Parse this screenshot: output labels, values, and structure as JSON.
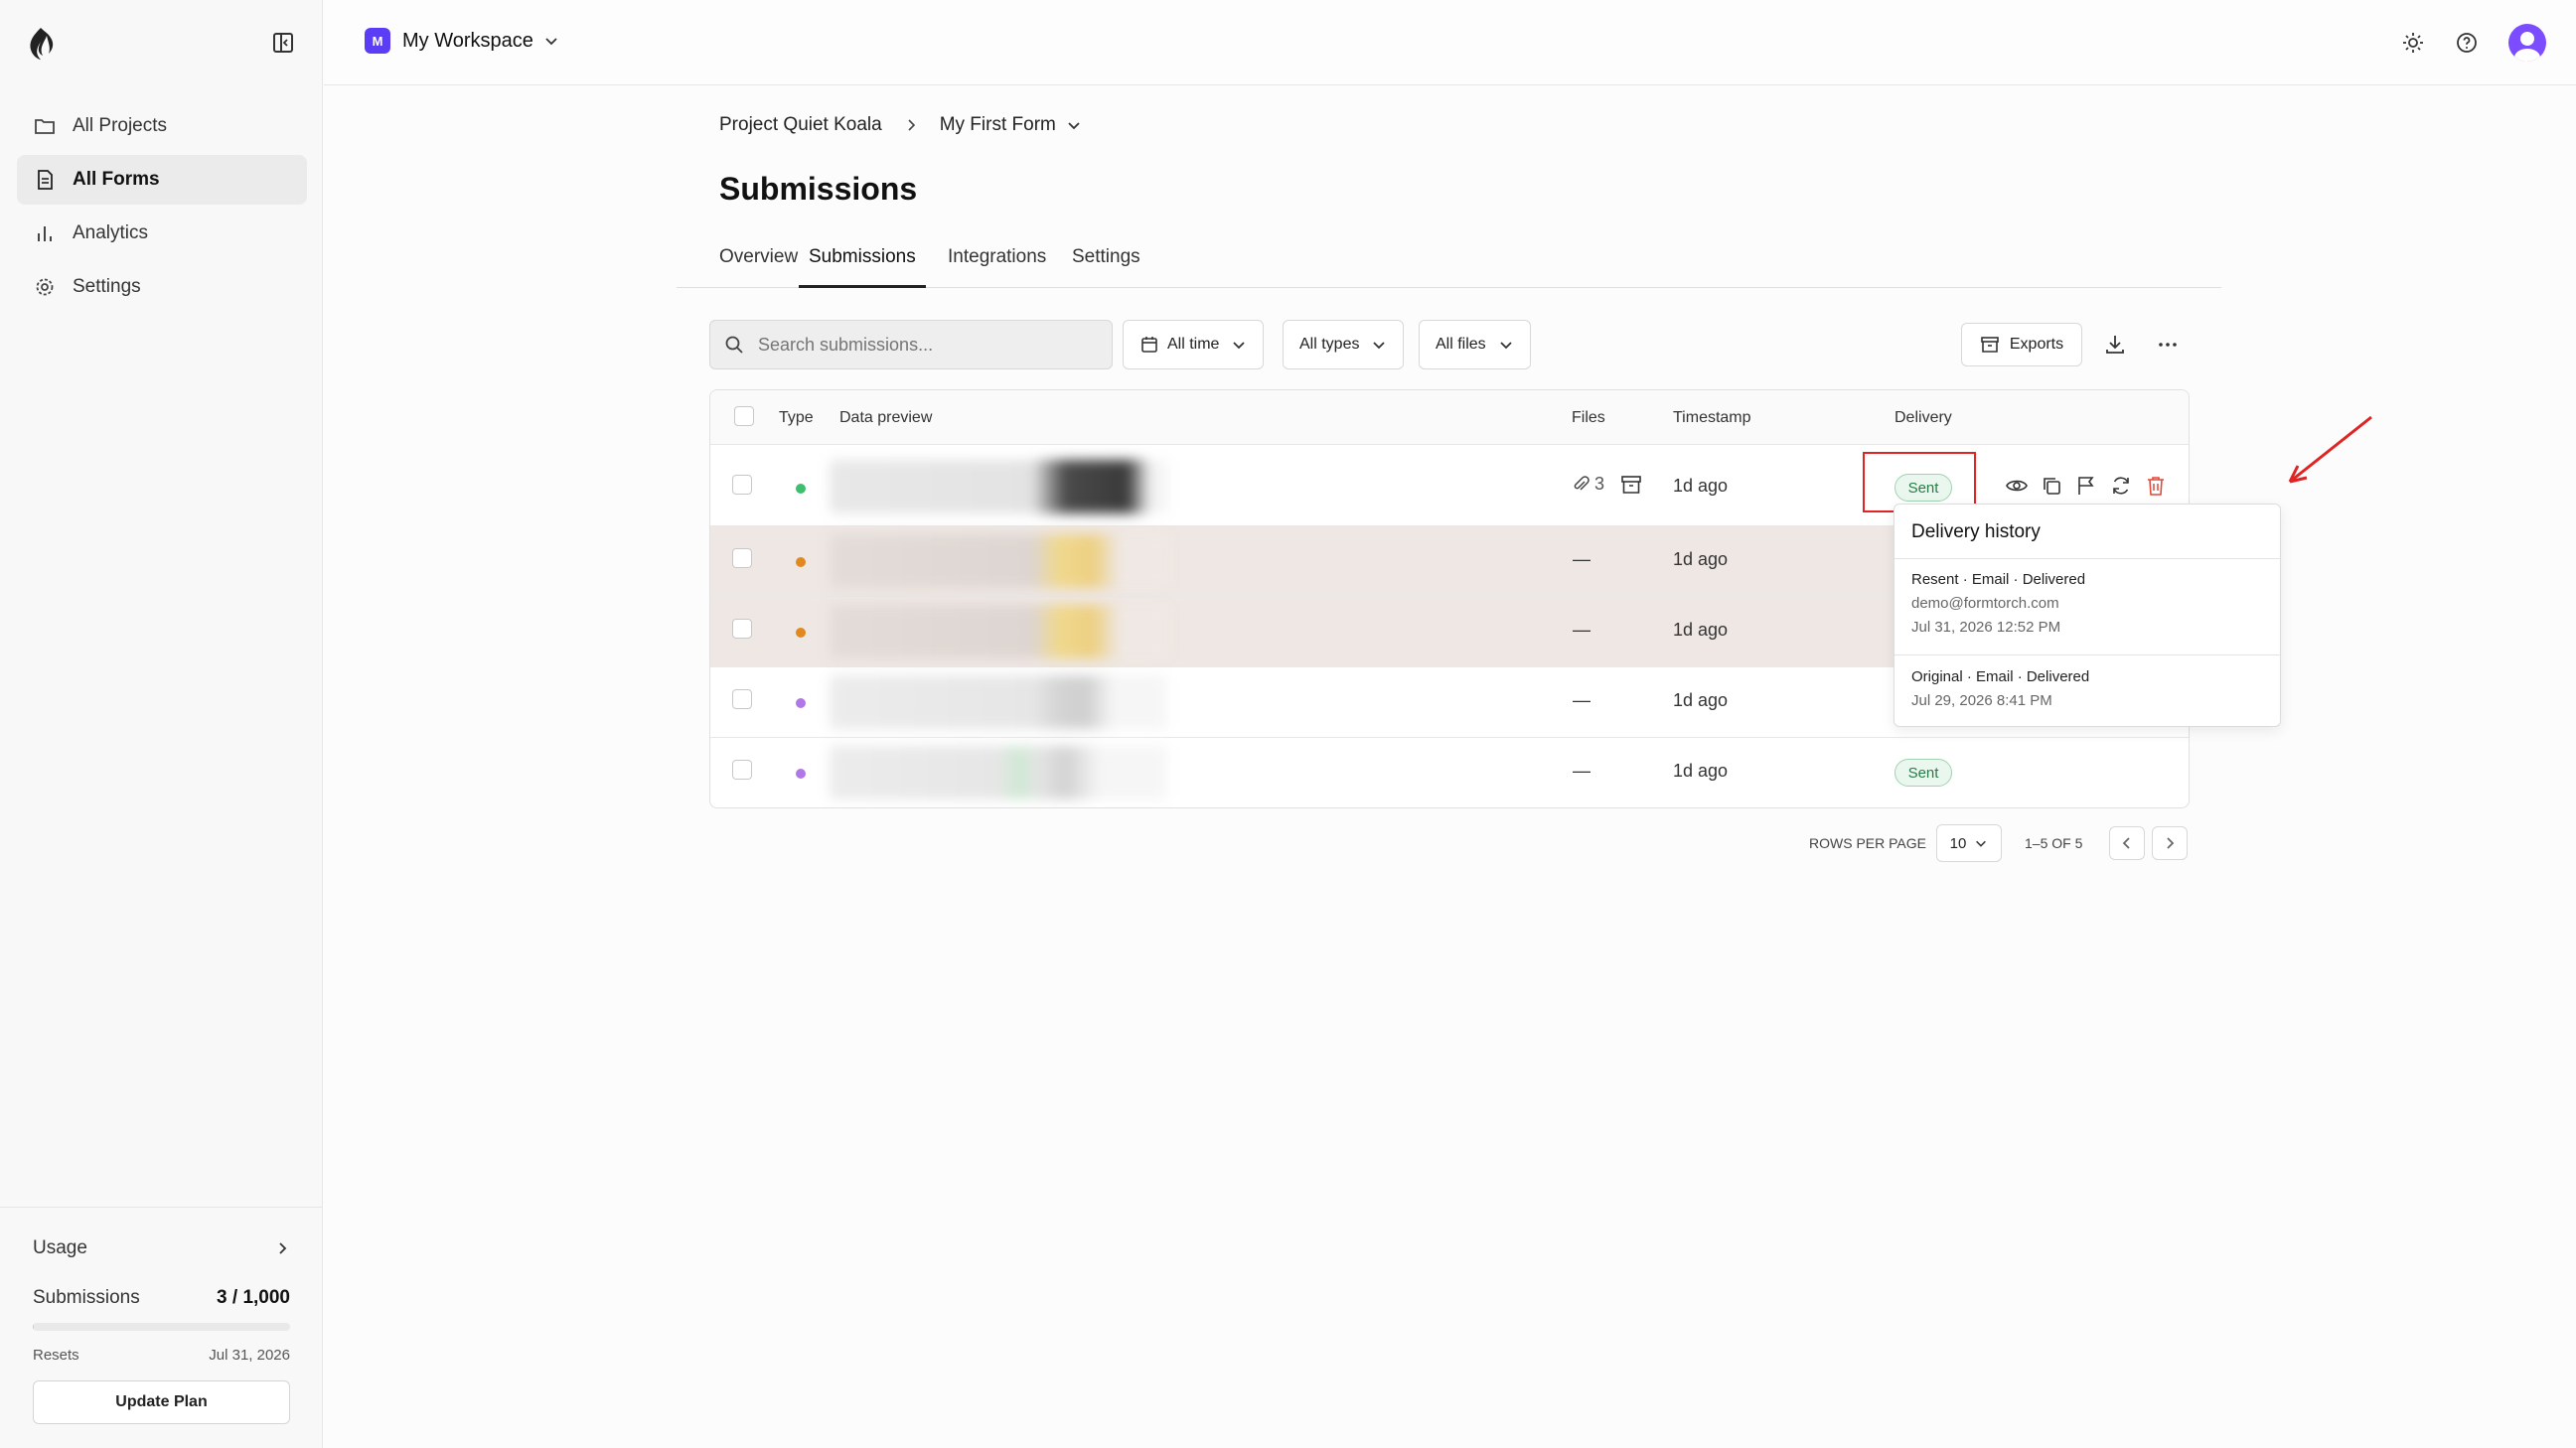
{
  "sidebar": {
    "nav": [
      {
        "label": "All Projects",
        "icon": "folder-icon"
      },
      {
        "label": "All Forms",
        "icon": "file-icon",
        "active": true
      },
      {
        "label": "Analytics",
        "icon": "bar-chart-icon"
      },
      {
        "label": "Settings",
        "icon": "gear-icon"
      }
    ],
    "usage": {
      "title": "Usage",
      "submissions_label": "Submissions",
      "submissions_value": "3 / 1,000",
      "submissions_used_fraction": 0.003,
      "resets_label": "Resets",
      "resets_date": "Jul 31, 2026",
      "update_button": "Update Plan"
    }
  },
  "topbar": {
    "workspace_initial": "M",
    "workspace_name": "My Workspace",
    "workspace_color": "#5b3df5"
  },
  "breadcrumb": {
    "project": "Project Quiet Koala",
    "form": "My First Form"
  },
  "page": {
    "title": "Submissions",
    "tabs": [
      "Overview",
      "Submissions",
      "Integrations",
      "Settings"
    ],
    "active_tab": "Submissions"
  },
  "toolbar": {
    "search_placeholder": "Search submissions...",
    "filter_time": "All time",
    "filter_types": "All types",
    "filter_files": "All files",
    "exports_label": "Exports"
  },
  "table": {
    "headers": {
      "type": "Type",
      "data_preview": "Data preview",
      "files": "Files",
      "timestamp": "Timestamp",
      "delivery": "Delivery"
    },
    "rows": [
      {
        "type_color": "#3dbf6e",
        "files": "3",
        "timestamp": "1d  ago",
        "delivery": "Sent"
      },
      {
        "type_color": "#e0891f",
        "files": "—",
        "timestamp": "1d  ago",
        "delivery": ""
      },
      {
        "type_color": "#e0891f",
        "files": "—",
        "timestamp": "1d  ago",
        "delivery": ""
      },
      {
        "type_color": "#b277e6",
        "files": "—",
        "timestamp": "1d  ago",
        "delivery": ""
      },
      {
        "type_color": "#b277e6",
        "files": "—",
        "timestamp": "1d  ago",
        "delivery": "Sent"
      }
    ]
  },
  "delivery_history": {
    "title": "Delivery history",
    "entries": [
      {
        "head": "Resent · Email · Delivered",
        "recipient": "demo@formtorch.com",
        "time": "Jul 31, 2026 12:52 PM"
      },
      {
        "head": "Original · Email · Delivered",
        "time": "Jul 29, 2026 8:41 PM"
      }
    ]
  },
  "pagination": {
    "rows_per_page_label": "ROWS PER PAGE",
    "rows_per_page": "10",
    "range": "1–5 OF 5"
  },
  "annotation": {
    "highlight_color": "#e02424"
  }
}
